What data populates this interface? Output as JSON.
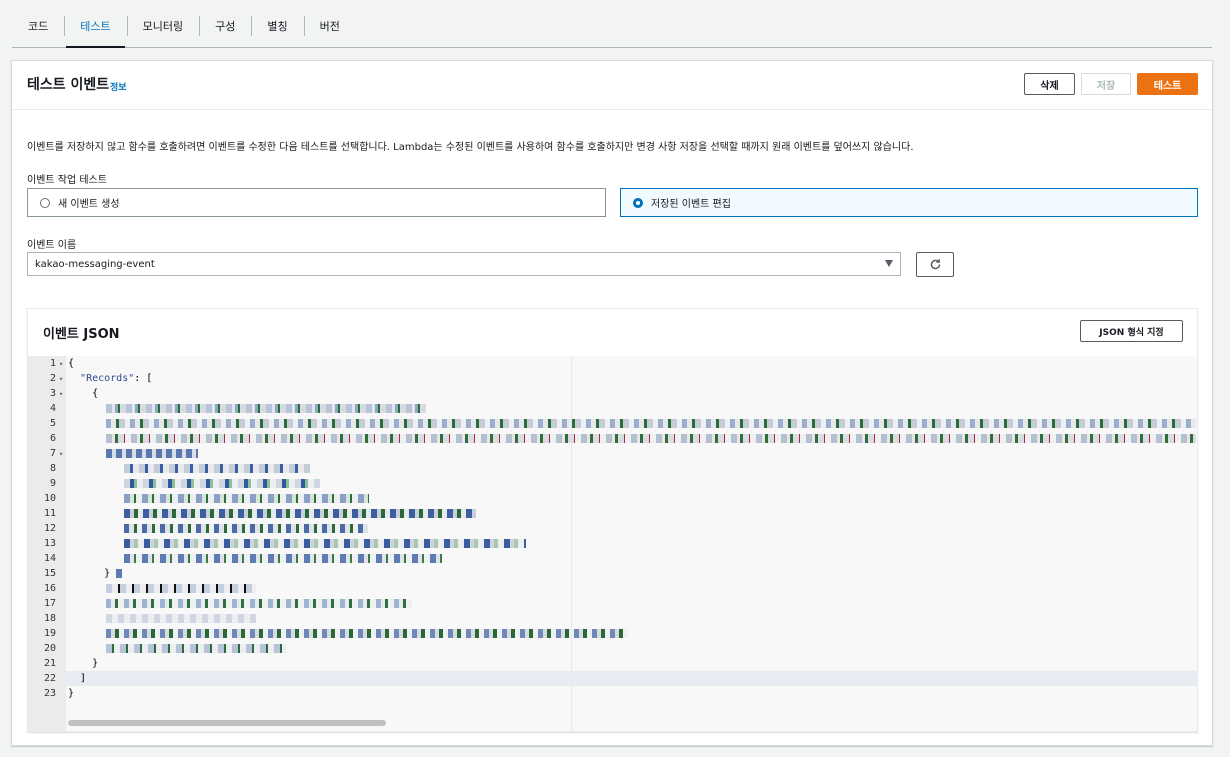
{
  "tabs": [
    {
      "label": "코드",
      "active": false
    },
    {
      "label": "테스트",
      "active": true
    },
    {
      "label": "모니터링",
      "active": false
    },
    {
      "label": "구성",
      "active": false
    },
    {
      "label": "별칭",
      "active": false
    },
    {
      "label": "버전",
      "active": false
    }
  ],
  "panel": {
    "title": "테스트 이벤트",
    "info": "정보",
    "delete_label": "삭제",
    "save_label": "저장",
    "test_label": "테스트",
    "description": "이벤트를 저장하지 않고 함수를 호출하려면 이벤트를 수정한 다음 테스트를 선택합니다. Lambda는 수정된 이벤트를 사용하여 함수를 호출하지만 변경 사항 저장을 선택할 때까지 원래 이벤트를 덮어쓰지 않습니다.",
    "action_label": "이벤트 작업 테스트",
    "option_new": "새 이벤트 생성",
    "option_edit": "저장된 이벤트 편집",
    "selected_option": "저장된 이벤트 편집",
    "event_name_label": "이벤트 이름",
    "event_name_value": "kakao-messaging-event"
  },
  "json_panel": {
    "title": "이벤트 JSON",
    "format_label": "JSON 형식 지정",
    "line_numbers": [
      "1",
      "2",
      "3",
      "4",
      "5",
      "6",
      "7",
      "8",
      "9",
      "10",
      "11",
      "12",
      "13",
      "14",
      "15",
      "16",
      "17",
      "18",
      "19",
      "20",
      "21",
      "22",
      "23"
    ],
    "foldable_lines": [
      "1",
      "2",
      "3",
      "7"
    ],
    "code": {
      "l1": "{",
      "l2_key": "\"Records\"",
      "l2_rest": ": [",
      "l3": "    {",
      "l15": "      }",
      "l21": "    }",
      "l22": "  ]",
      "l23": "}"
    },
    "current_line": "22"
  },
  "colors": {
    "accent": "#ec7211",
    "link": "#0073bb",
    "tab_active": "#0073bb"
  }
}
